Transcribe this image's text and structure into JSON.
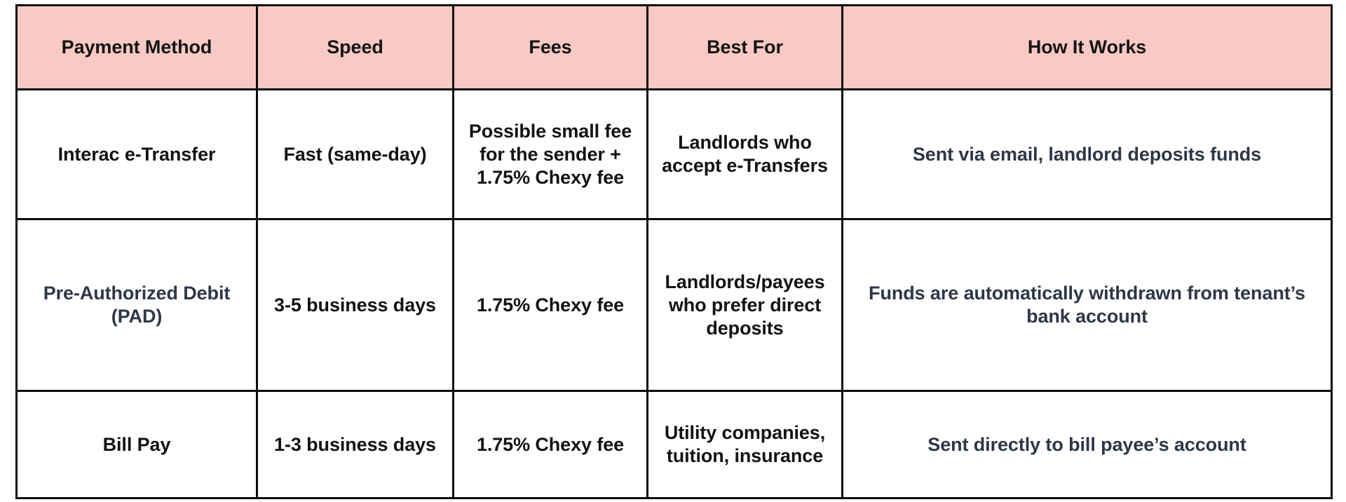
{
  "table": {
    "columns": [
      {
        "key": "payment_method",
        "label": "Payment Method"
      },
      {
        "key": "speed",
        "label": "Speed"
      },
      {
        "key": "fees",
        "label": "Fees"
      },
      {
        "key": "best_for",
        "label": "Best For"
      },
      {
        "key": "how_it_works",
        "label": "How It Works"
      }
    ],
    "header_background": "#f9c9c4",
    "header_text_color": "#141414",
    "body_text_color": "#131313",
    "accent_text_color": "#2d3748",
    "border_color": "#0b0b0b",
    "rows": [
      {
        "payment_method": "Interac e-Transfer",
        "speed": "Fast (same-day)",
        "fees": "Possible small fee for the sender + 1.75% Chexy fee",
        "best_for": "Landlords who accept e-Transfers",
        "how_it_works": "Sent via email, landlord deposits funds"
      },
      {
        "payment_method": "Pre-Authorized Debit (PAD)",
        "speed": "3-5 business days",
        "fees": "1.75% Chexy fee",
        "best_for": "Landlords/payees who prefer direct deposits",
        "how_it_works": "Funds are automatically withdrawn from tenant’s bank account"
      },
      {
        "payment_method": "Bill Pay",
        "speed": "1-3 business days",
        "fees": "1.75% Chexy fee",
        "best_for": "Utility companies, tuition, insurance",
        "how_it_works": "Sent directly to bill payee’s account"
      }
    ]
  }
}
